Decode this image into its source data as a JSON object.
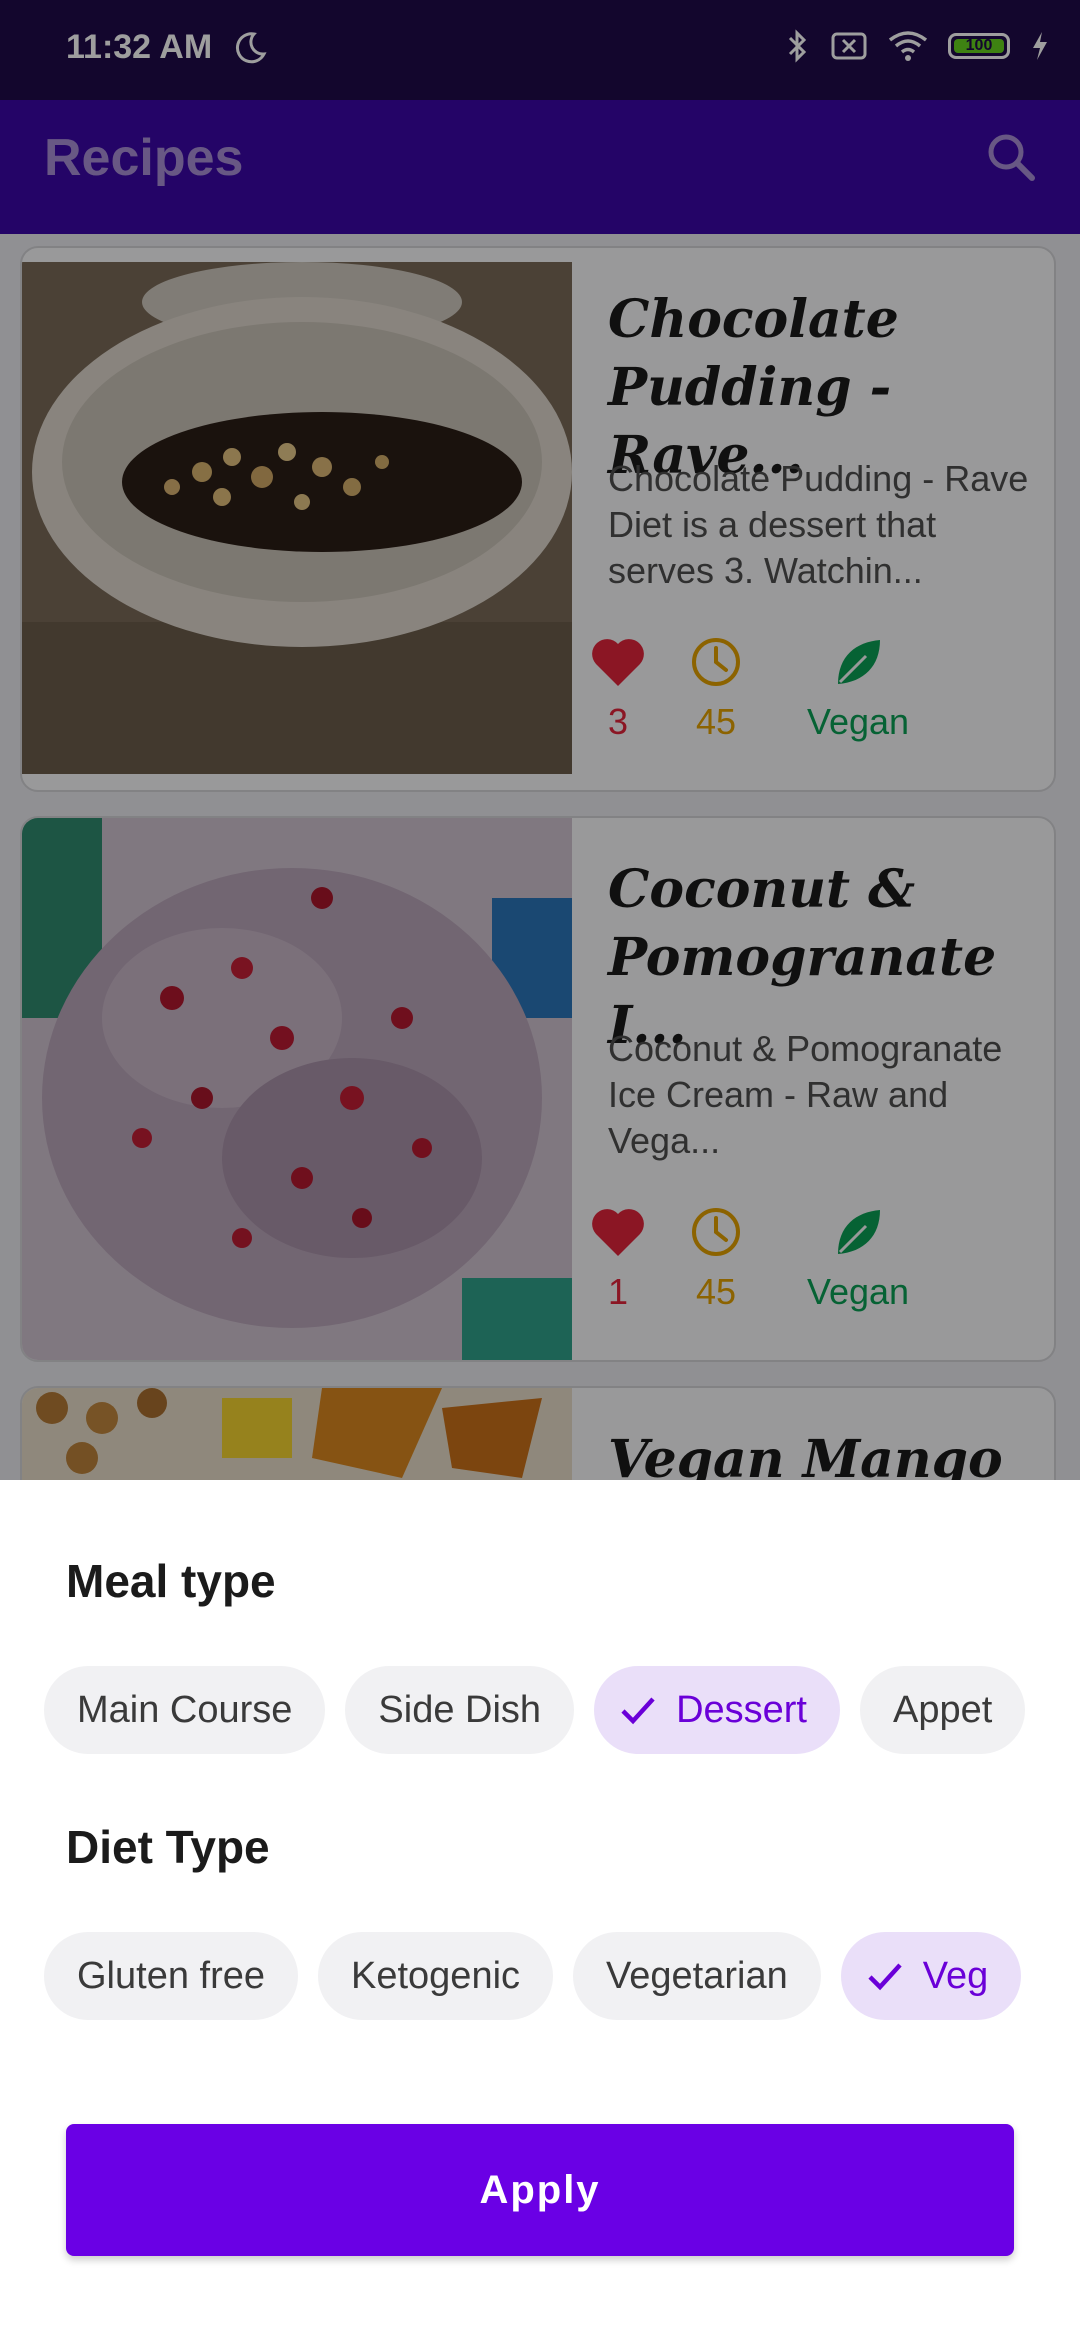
{
  "status_bar": {
    "time": "11:32 AM",
    "battery": "100"
  },
  "app_bar": {
    "title": "Recipes"
  },
  "recipes": [
    {
      "title": "Chocolate Pudding - Rave...",
      "description": "Chocolate Pudding - Rave Diet is a dessert that serves 3. Watchin...",
      "likes": "3",
      "minutes": "45",
      "diet": "Vegan"
    },
    {
      "title": "Coconut & Pomogranate I...",
      "description": "Coconut & Pomogranate Ice Cream - Raw and Vega...",
      "likes": "1",
      "minutes": "45",
      "diet": "Vegan"
    },
    {
      "title": "Vegan Mango"
    }
  ],
  "filter_sheet": {
    "meal_type": {
      "title": "Meal type",
      "chips": [
        {
          "label": "Main Course",
          "selected": false
        },
        {
          "label": "Side Dish",
          "selected": false
        },
        {
          "label": "Dessert",
          "selected": true
        },
        {
          "label": "Appet",
          "selected": false
        }
      ]
    },
    "diet_type": {
      "title": "Diet Type",
      "chips": [
        {
          "label": "Gluten free",
          "selected": false
        },
        {
          "label": "Ketogenic",
          "selected": false
        },
        {
          "label": "Vegetarian",
          "selected": false
        },
        {
          "label": "Veg",
          "selected": true
        }
      ]
    },
    "apply_label": "Apply"
  },
  "colors": {
    "status_bar": "#1f0a4a",
    "app_bar": "#3a07a6",
    "accent": "#6a00e5",
    "likes_red": "#e0243a",
    "clock_yellow": "#e2a000",
    "vegan_green": "#0b9f55",
    "selected_chip_bg": "#eadff9"
  }
}
